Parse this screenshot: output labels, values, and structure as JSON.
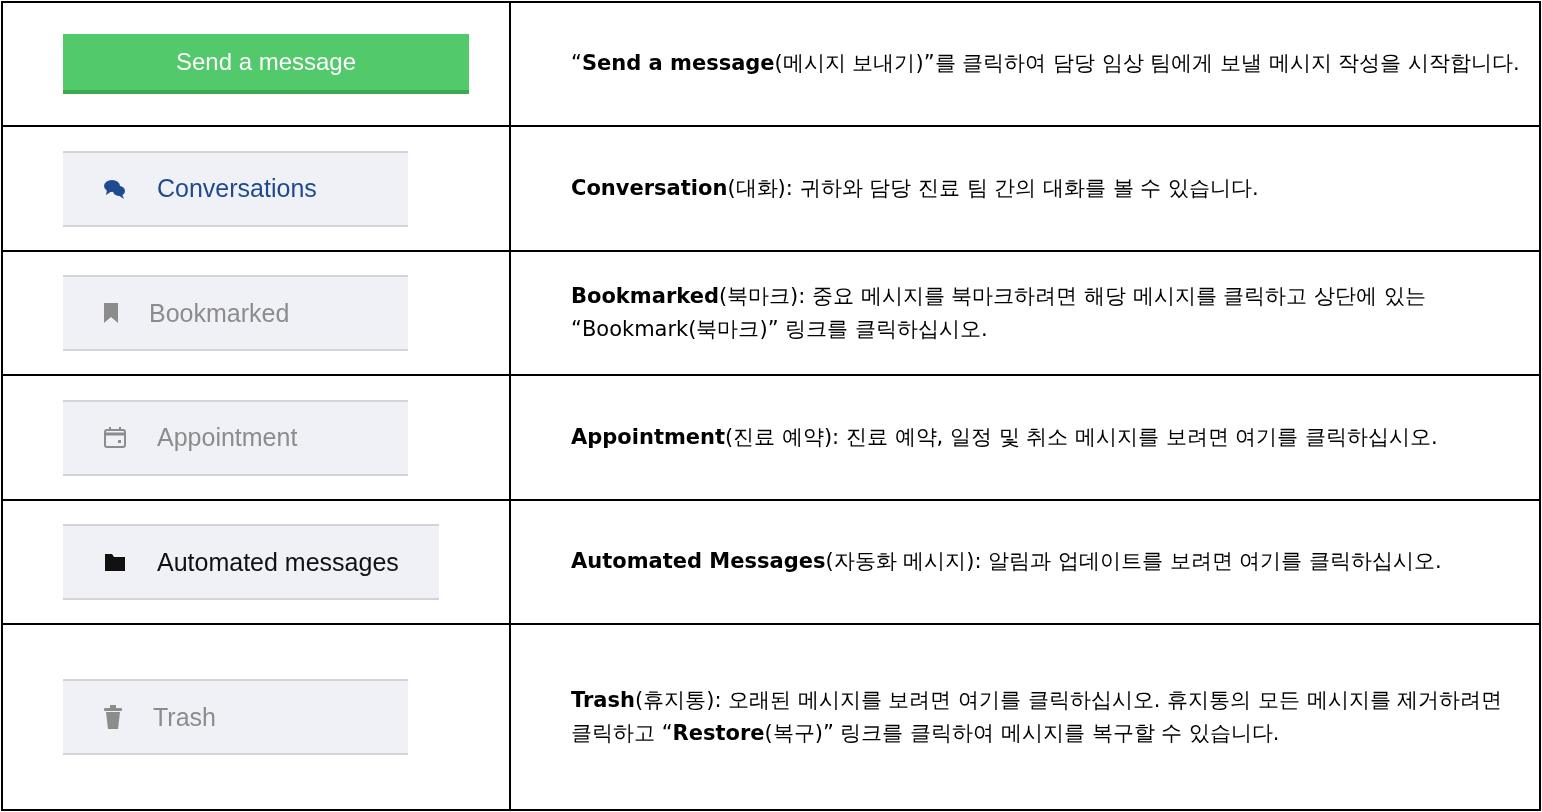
{
  "rows": [
    {
      "button": {
        "kind": "primary",
        "label": "Send a message"
      },
      "description": "“**Send a message**(메시지 보내기)”를 클릭하여 담당 임상 팀에게 보낼 메시지 작성을 시작합니다."
    },
    {
      "button": {
        "kind": "nav",
        "label": "Conversations",
        "color": "#1f4a8f"
      },
      "description": "**Conversation**(대화): 귀하와 담당 진료 팀 간의 대화를 볼 수 있습니다."
    },
    {
      "button": {
        "kind": "nav",
        "label": "Bookmarked",
        "color": "#8c8c8c"
      },
      "description": "**Bookmarked**(북마크): 중요 메시지를 북마크하려면 해당 메시지를 클릭하고 상단에 있는 “Bookmark(북마크)” 링크를 클릭하십시오."
    },
    {
      "button": {
        "kind": "nav",
        "label": "Appointment",
        "color": "#8c8c8c"
      },
      "description": "**Appointment**(진료 예약): 진료 예약, 일정 및 취소 메시지를 보려면 여기를 클릭하십시오."
    },
    {
      "button": {
        "kind": "nav",
        "label": "Automated messages",
        "color": "#111111"
      },
      "description": "**Automated Messages**(자동화 메시지): 알림과 업데이트를 보려면 여기를 클릭하십시오."
    },
    {
      "button": {
        "kind": "nav",
        "label": "Trash",
        "color": "#8c8c8c"
      },
      "description": "**Trash**(휴지통): 오래된 메시지를 보려면 여기를 클릭하십시오. 휴지통의 모든 메시지를 제거하려면 클릭하고 “**Restore**(복구)” 링크를 클릭하여 메시지를 복구할 수 있습니다."
    }
  ]
}
